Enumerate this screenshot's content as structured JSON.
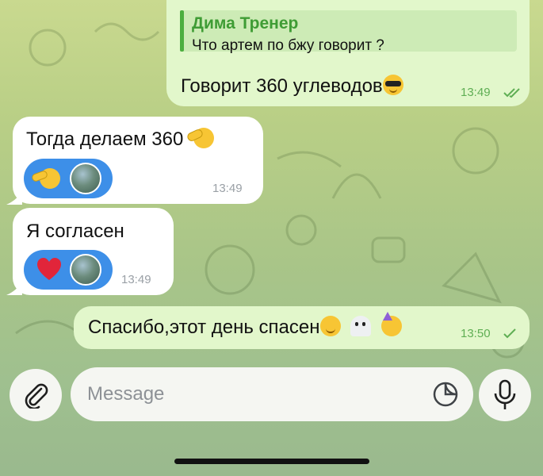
{
  "messages": [
    {
      "reply": {
        "author": "Дима Тренер",
        "text": "Что артем по бжу говорит ?"
      },
      "text": "Говорит 360 углеводов",
      "time": "13:49"
    },
    {
      "text": "Тогда делаем 360",
      "time": "13:49"
    },
    {
      "text": "Я согласен",
      "time": "13:49"
    },
    {
      "text": "Спасибо,этот день спасен",
      "time": "13:50"
    }
  ],
  "composer": {
    "placeholder": "Message"
  },
  "colors": {
    "outgoing_bubble": "#e2f7cb",
    "incoming_bubble": "#ffffff",
    "reaction_pill": "#3d8fe8",
    "reply_accent": "#4caf3f",
    "time_outgoing": "#5fae54"
  },
  "icons": [
    "double-check-icon",
    "single-check-icon",
    "attach-icon",
    "sticker-icon",
    "microphone-icon",
    "heart-icon"
  ]
}
